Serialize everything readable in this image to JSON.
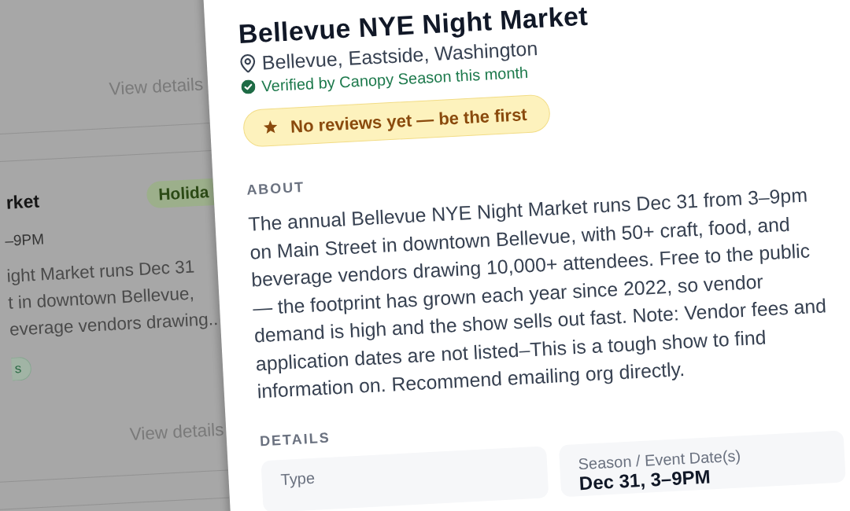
{
  "listing_cards": [
    {
      "link": "View details"
    },
    {
      "title": "rket",
      "badge": "Holida",
      "date": "–9PM",
      "description_lines": [
        "ight Market runs Dec 31",
        "t in downtown Bellevue,",
        "everage vendors drawing.."
      ],
      "tags": [
        "s"
      ],
      "link": "View details"
    }
  ],
  "drawer": {
    "title": "Bellevue NYE Night Market",
    "location": "Bellevue, Eastside, Washington",
    "verified": "Verified by Canopy Season this month",
    "reviews_button": "No reviews yet — be the first",
    "sections": [
      {
        "kind": "text",
        "heading": "ABOUT",
        "text": "The annual Bellevue NYE Night Market runs Dec 31 from 3–9pm on Main Street in downtown Bellevue, with 50+ craft, food, and beverage vendors drawing 10,000+ attendees. Free to the public — the footprint has grown each year since 2022, so vendor demand is high and the show sells out fast. Note: Vendor fees and application dates are not listed–This is a tough show to find information on. Recommend emailing org directly."
      },
      {
        "kind": "fields",
        "heading": "DETAILS",
        "fields": [
          {
            "label": "Type"
          },
          {
            "label": "Season / Event Date(s)",
            "value": "Dec 31, 3–9PM"
          }
        ]
      }
    ]
  }
}
